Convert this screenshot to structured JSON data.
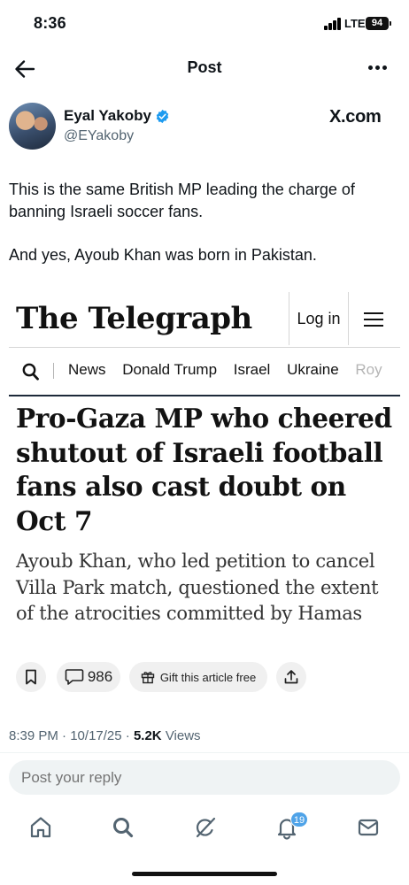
{
  "status_bar": {
    "time": "8:36",
    "network": "LTE",
    "battery": "94"
  },
  "header": {
    "title": "Post"
  },
  "author": {
    "name": "Eyal Yakoby",
    "handle": "@EYakoby",
    "source": "X.com"
  },
  "tweet": {
    "paragraphs": [
      "This is the same British MP leading the charge of banning Israeli soccer fans.",
      "And yes, Ayoub Khan was born in Pakistan."
    ]
  },
  "article": {
    "publisher": "The Telegraph",
    "login_label": "Log in",
    "nav_items": [
      "News",
      "Donald Trump",
      "Israel",
      "Ukraine",
      "Roy"
    ],
    "headline": "Pro-Gaza MP who cheered shutout of Israeli football fans also cast doubt on Oct 7",
    "subheadline": "Ayoub Khan, who led petition to cancel Villa Park match, questioned the extent of the atrocities committed by Hamas",
    "comment_count": "986",
    "gift_label": "Gift this article free"
  },
  "meta": {
    "time": "8:39 PM",
    "date": "10/17/25",
    "views": "5.2K",
    "views_label": "Views"
  },
  "reply": {
    "placeholder": "Post your reply"
  },
  "bottom_nav": {
    "notifications_badge": "19"
  },
  "colors": {
    "accent": "#1d9bf0",
    "muted": "#536471",
    "badge": "#4fa3e8",
    "article_rule": "#1d2a3a"
  }
}
